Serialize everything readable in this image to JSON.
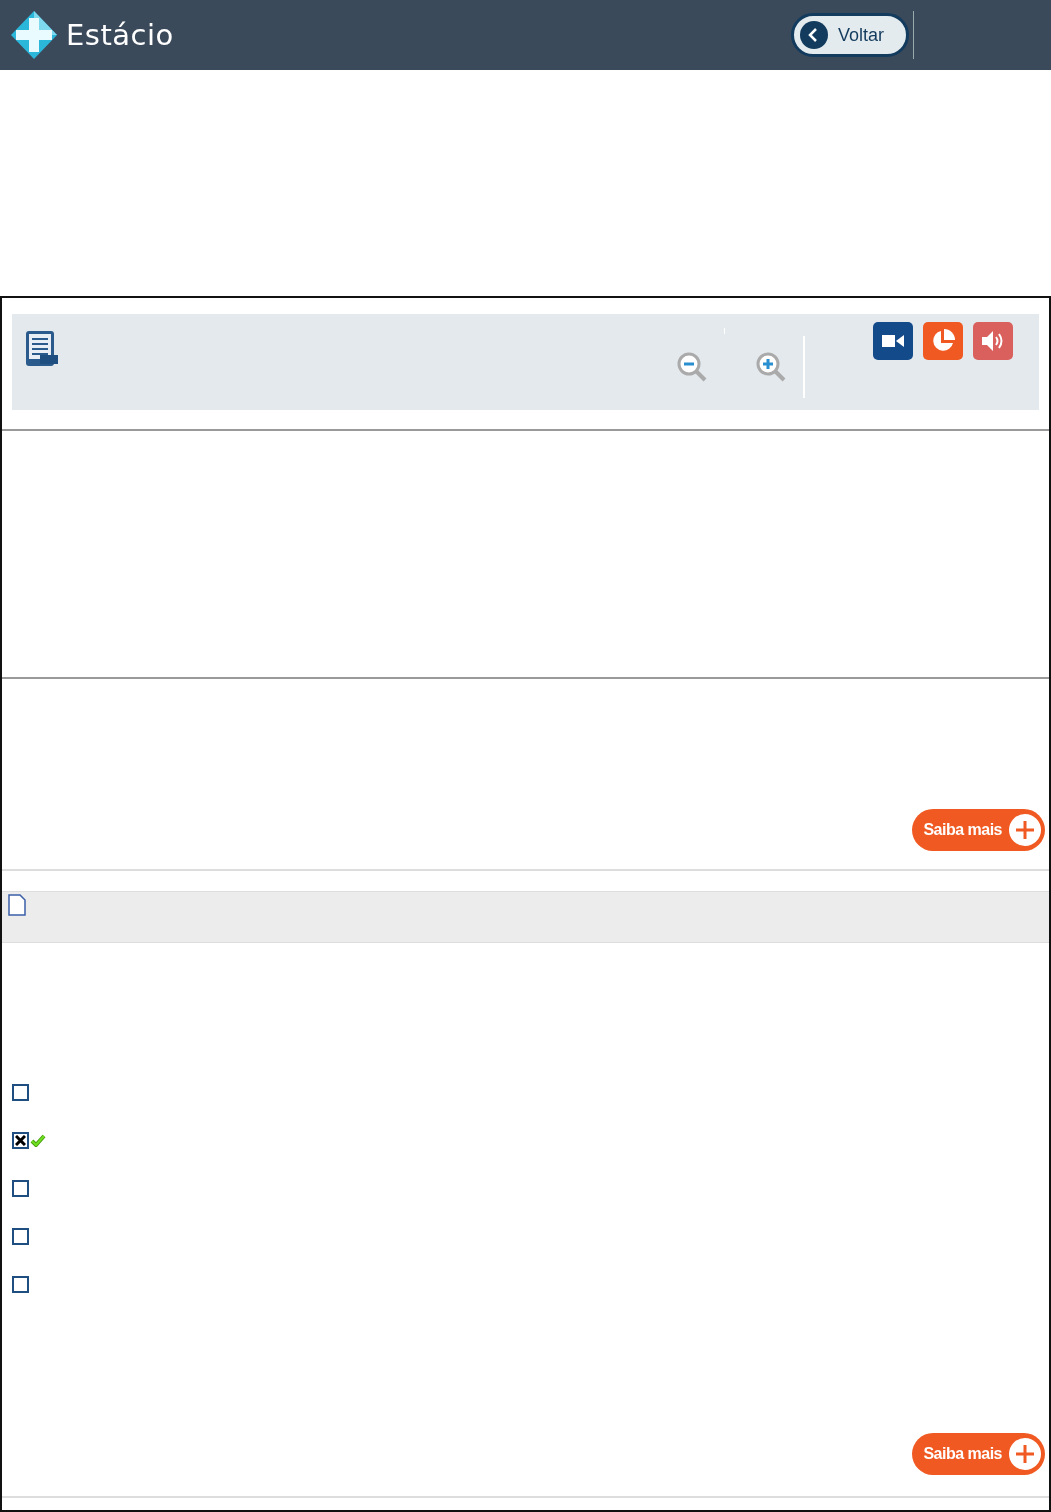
{
  "header": {
    "brand": "Estácio",
    "back_button": "Voltar"
  },
  "sections": [
    {
      "saiba_mais": "Saiba mais"
    }
  ],
  "question": {
    "options": [
      {
        "checked": false,
        "correct": false
      },
      {
        "checked": true,
        "correct": true
      },
      {
        "checked": false,
        "correct": false
      },
      {
        "checked": false,
        "correct": false
      },
      {
        "checked": false,
        "correct": false
      }
    ],
    "saiba_mais": "Saiba mais"
  }
}
